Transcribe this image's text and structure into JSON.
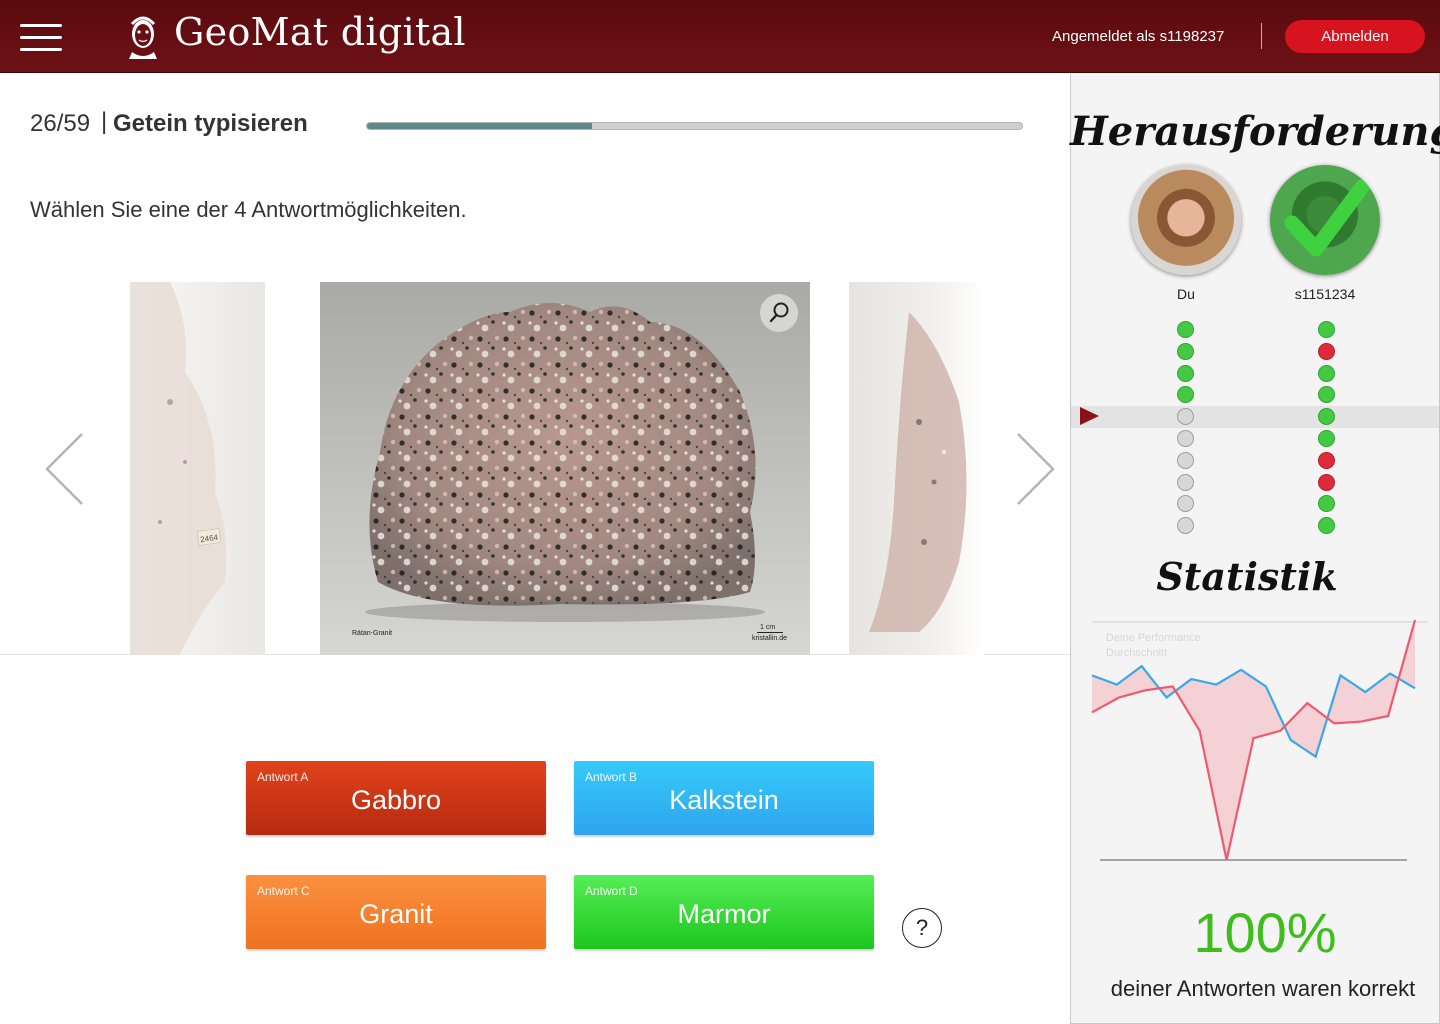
{
  "header": {
    "app_name": "GeoMat digital",
    "login_text": "Angemeldet als s1198237",
    "logout_label": "Abmelden"
  },
  "quiz": {
    "progress_text": "26/59",
    "separator": "|",
    "title": "Getein typisieren",
    "progress_fraction": 0.3438,
    "instruction": "Wählen Sie eine der 4 Antwortmöglichkeiten."
  },
  "carousel": {
    "caption": "Rätan-Granit",
    "scale_label": "1 cm",
    "credit": "kristallin.de",
    "side_label": "2464"
  },
  "answers": [
    {
      "label": "Antwort A",
      "text": "Gabbro"
    },
    {
      "label": "Antwort B",
      "text": "Kalkstein"
    },
    {
      "label": "Antwort C",
      "text": "Granit"
    },
    {
      "label": "Antwort D",
      "text": "Marmor"
    }
  ],
  "help_label": "?",
  "sidebar": {
    "challenge_title": "Herausforderung",
    "player_you": "Du",
    "player_opponent": "s1151234",
    "you_results": [
      "ok",
      "ok",
      "ok",
      "ok",
      "empty",
      "empty",
      "empty",
      "empty",
      "empty",
      "empty"
    ],
    "opponent_results": [
      "ok",
      "bad",
      "ok",
      "ok",
      "ok",
      "ok",
      "bad",
      "bad",
      "ok",
      "ok"
    ],
    "current_row": 4,
    "stats_title": "Statistik",
    "legend_line1": "Deine Performance",
    "legend_line2": "Durchschnitt",
    "percent": "100%",
    "percent_label": "deiner Antworten waren korrekt"
  },
  "chart_data": {
    "type": "line",
    "series": [
      {
        "name": "Deine Performance",
        "color": "#ef5a6c",
        "values": [
          50,
          58,
          62,
          64,
          40,
          -30,
          36,
          40,
          55,
          44,
          45,
          48,
          100
        ]
      },
      {
        "name": "Durchschnitt",
        "color": "#3ba8e6",
        "values": [
          70,
          65,
          75,
          58,
          68,
          65,
          73,
          64,
          35,
          26,
          70,
          61,
          71,
          63
        ]
      }
    ]
  },
  "colors": {
    "header_bg": "#5a0a0e",
    "logout_bg": "#d7131f",
    "answer_a": "#c9331a",
    "answer_b": "#30b5f5",
    "answer_c": "#f77e2c",
    "answer_d": "#33d433",
    "percent": "#3fbd1c"
  }
}
